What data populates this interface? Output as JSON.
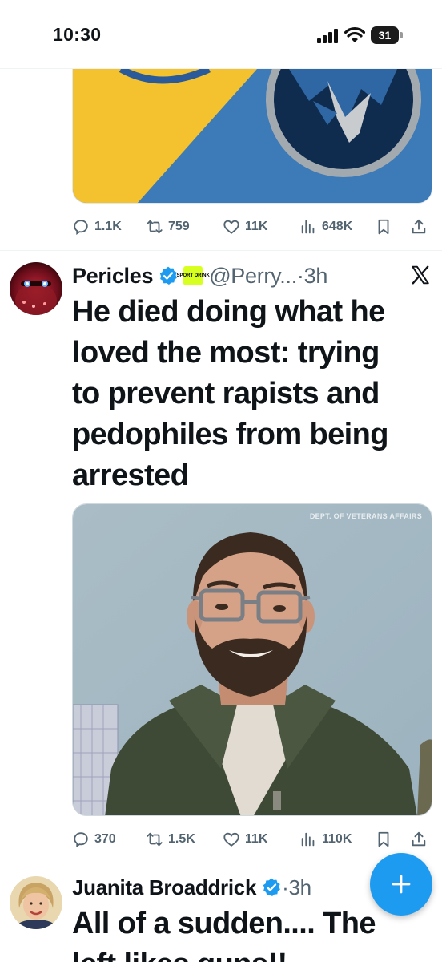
{
  "status_bar": {
    "time": "10:30",
    "battery_level": "31"
  },
  "tweet1": {
    "actions": {
      "replies": "1.1K",
      "reposts": "759",
      "likes": "11K",
      "views": "648K"
    }
  },
  "tweet2": {
    "author_name": "Pericles",
    "handle": "@Perry...",
    "time_ago": "·3h",
    "badge_text": "SPORT DRINK",
    "text_lines": [
      "He died doing what he",
      "loved the most: trying",
      "to prevent rapists and",
      "pedophiles from being",
      "arrested"
    ],
    "photo_credit": "DEPT. OF VETERANS AFFAIRS",
    "actions": {
      "replies": "370",
      "reposts": "1.5K",
      "likes": "11K",
      "views": "110K"
    }
  },
  "tweet3": {
    "author_name": "Juanita Broaddrick",
    "time_ago": "·3h",
    "text_lines": [
      "All of a sudden.... The",
      "left likes guns!!"
    ]
  },
  "icons": {
    "reply": "reply-icon",
    "repost": "repost-icon",
    "like": "heart-icon",
    "views": "views-icon",
    "bookmark": "bookmark-icon",
    "share": "share-icon",
    "compose": "plus-icon",
    "platform": "x-logo-icon",
    "verified": "verified-badge-icon"
  },
  "colors": {
    "accent": "#1d9bf0",
    "secondary_text": "#536471",
    "primary_text": "#0f1419",
    "warriors_yellow": "#fdb927",
    "timberwolves_blue": "#236192"
  }
}
